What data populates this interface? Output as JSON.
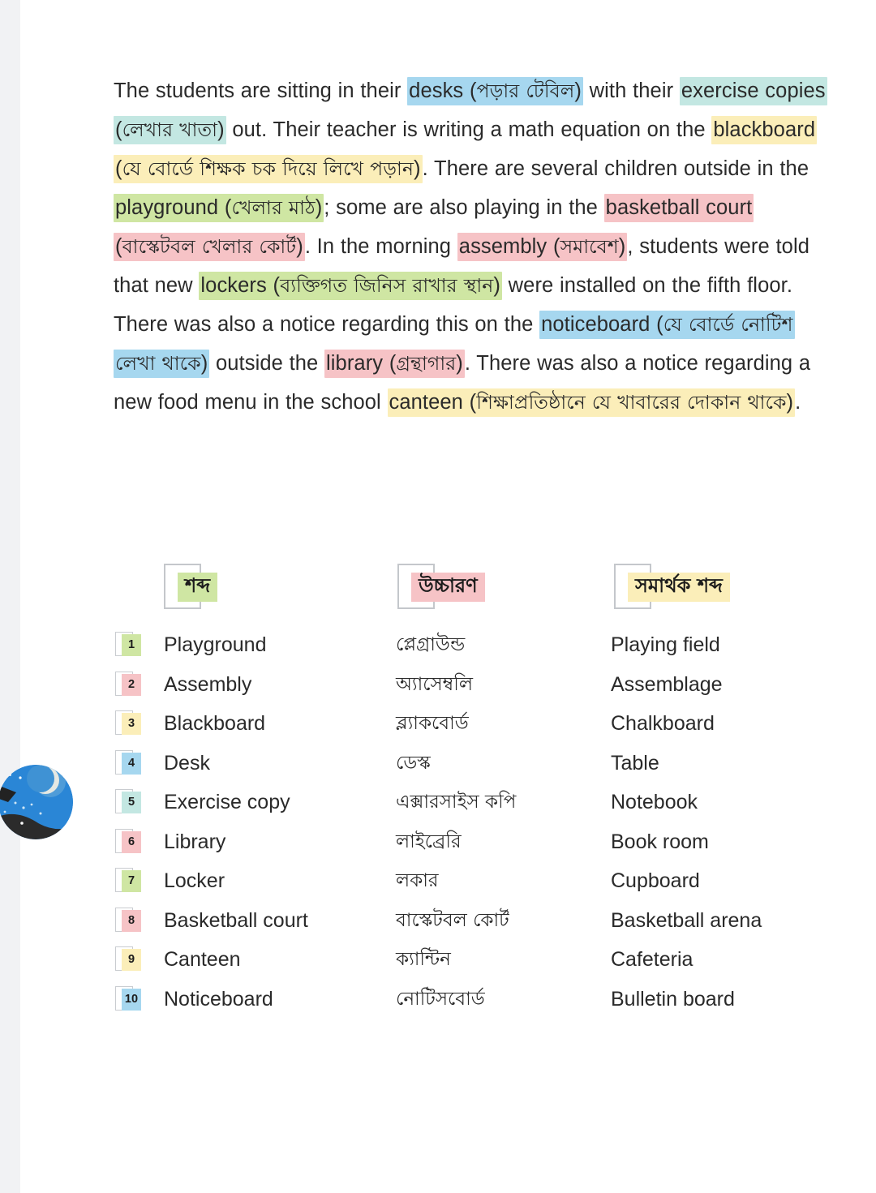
{
  "colors": {
    "blue": "#a6d7ef",
    "teal": "#c3e7e2",
    "yellow": "#fbeeb9",
    "green": "#cfe6a3",
    "pink": "#f6c3c6",
    "page_background": "#ffffff",
    "gutter": "#f1f2f4",
    "text": "#2a2a2a"
  },
  "paragraph": {
    "segments": [
      {
        "text": "The students are sitting in their ",
        "highlight": "none"
      },
      {
        "text": "desks (পড়ার টেবিল)",
        "highlight": "blue"
      },
      {
        "text": " with their ",
        "highlight": "none"
      },
      {
        "text": "exercise copies (লেখার খাতা)",
        "highlight": "teal"
      },
      {
        "text": " out. Their teacher is writing a math equation on the ",
        "highlight": "none"
      },
      {
        "text": "blackboard (যে বোর্ডে শিক্ষক চক দিয়ে লিখে পড়ান)",
        "highlight": "yellow"
      },
      {
        "text": ". There are several children outside in the ",
        "highlight": "none"
      },
      {
        "text": "playground (খেলার মাঠ)",
        "highlight": "green"
      },
      {
        "text": "; some are also playing in the ",
        "highlight": "none"
      },
      {
        "text": "basketball court (বাস্কেটবল খেলার কোর্ট)",
        "highlight": "pink"
      },
      {
        "text": ". In the morning ",
        "highlight": "none"
      },
      {
        "text": "assembly (সমাবেশ)",
        "highlight": "pink"
      },
      {
        "text": ", students were told that new ",
        "highlight": "none"
      },
      {
        "text": "lockers (ব্যক্তিগত জিনিস রাখার স্থান)",
        "highlight": "green"
      },
      {
        "text": " were installed on the fifth floor. There was also a notice regarding this on the ",
        "highlight": "none"
      },
      {
        "text": "noticeboard (যে বোর্ডে নোটিশ লেখা থাকে)",
        "highlight": "blue"
      },
      {
        "text": " outside the ",
        "highlight": "none"
      },
      {
        "text": "library (গ্রন্থাগার)",
        "highlight": "pink"
      },
      {
        "text": ". There was also a notice regarding a new food menu in the school ",
        "highlight": "none"
      },
      {
        "text": "canteen (শিক্ষাপ্রতিষ্ঠানে যে খাবারের দোকান থাকে)",
        "highlight": "yellow"
      },
      {
        "text": ".",
        "highlight": "none"
      }
    ]
  },
  "table": {
    "headers": [
      {
        "label": "শব্দ",
        "highlight": "green"
      },
      {
        "label": "উচ্চারণ",
        "highlight": "pink"
      },
      {
        "label": "সমার্থক শব্দ",
        "highlight": "yellow"
      }
    ],
    "rows": [
      {
        "num": "1",
        "word": "Playground",
        "pron": "প্লেগ্রাউন্ড",
        "syn": "Playing field",
        "highlight": "green"
      },
      {
        "num": "2",
        "word": "Assembly",
        "pron": "অ্যাসেম্বলি",
        "syn": "Assemblage",
        "highlight": "pink"
      },
      {
        "num": "3",
        "word": "Blackboard",
        "pron": "ব্ল্যাকবোর্ড",
        "syn": "Chalkboard",
        "highlight": "yellow"
      },
      {
        "num": "4",
        "word": "Desk",
        "pron": "ডেস্ক",
        "syn": "Table",
        "highlight": "blue"
      },
      {
        "num": "5",
        "word": "Exercise copy",
        "pron": "এক্সারসাইস কপি",
        "syn": "Notebook",
        "highlight": "teal"
      },
      {
        "num": "6",
        "word": "Library",
        "pron": "লাইব্রেরি",
        "syn": "Book room",
        "highlight": "pink"
      },
      {
        "num": "7",
        "word": "Locker",
        "pron": "লকার",
        "syn": "Cupboard",
        "highlight": "green"
      },
      {
        "num": "8",
        "word": "Basketball court",
        "pron": "বাস্কেটবল কোর্ট",
        "syn": "Basketball arena",
        "highlight": "pink"
      },
      {
        "num": "9",
        "word": "Canteen",
        "pron": "ক্যান্টিন",
        "syn": "Cafeteria",
        "highlight": "yellow"
      },
      {
        "num": "10",
        "word": "Noticeboard",
        "pron": "নোটিসবোর্ড",
        "syn": "Bulletin board",
        "highlight": "blue"
      }
    ]
  },
  "avatar": {
    "icon": "night-sky-moon-avatar"
  }
}
